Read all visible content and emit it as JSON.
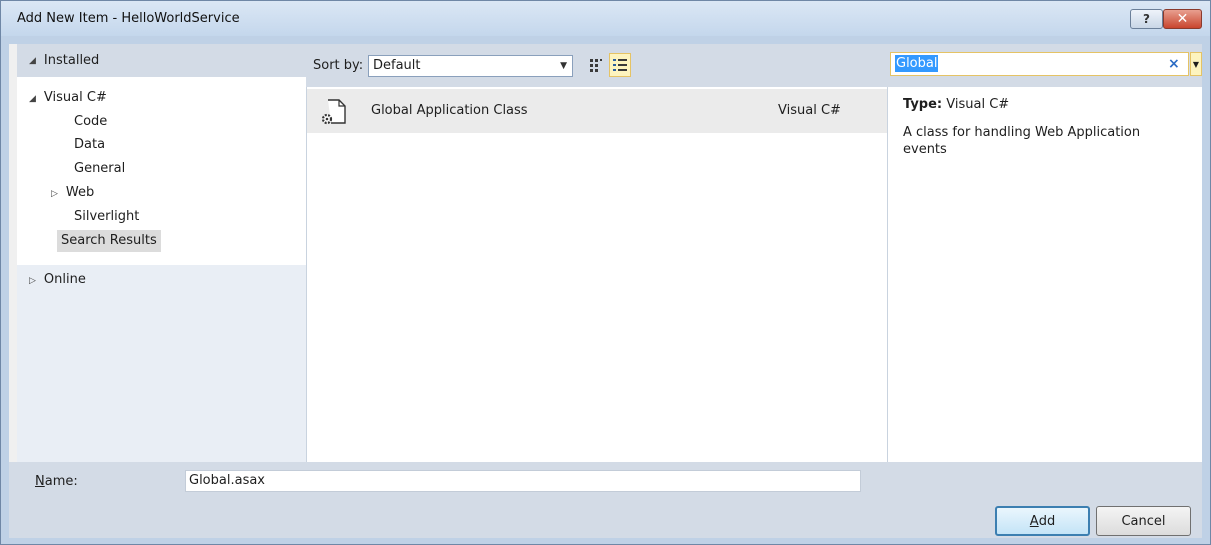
{
  "window": {
    "title": "Add New Item - HelloWorldService",
    "help_label": "?",
    "close_label": "✕"
  },
  "tree": {
    "installed_label": "Installed",
    "items": [
      {
        "label": "Visual C#",
        "expander": "◢"
      },
      {
        "label": "Code"
      },
      {
        "label": "Data"
      },
      {
        "label": "General"
      },
      {
        "label": "Web",
        "expander": "▷"
      },
      {
        "label": "Silverlight"
      },
      {
        "label": "Search Results",
        "selected": true
      }
    ],
    "online_label": "Online"
  },
  "sort": {
    "label": "Sort by:",
    "value": "Default"
  },
  "templates": [
    {
      "name": "Global Application Class",
      "language": "Visual C#",
      "icon": "web-config-gear-icon"
    }
  ],
  "search": {
    "value": "Global",
    "clear_label": "×"
  },
  "details": {
    "type_label": "Type:",
    "type_value": "Visual C#",
    "description": "A class for handling Web Application events"
  },
  "footer": {
    "name_label_accesskey": "N",
    "name_label_rest": "ame:",
    "name_value": "Global.asax",
    "add_accesskey": "A",
    "add_rest": "dd",
    "cancel_label": "Cancel"
  },
  "colors": {
    "title_gradient_top": "#dbe7f5",
    "panel_header": "#d3dbe6",
    "selection": "#dcdcdc",
    "search_highlight": "#3399ff",
    "close_red": "#c9452e"
  }
}
